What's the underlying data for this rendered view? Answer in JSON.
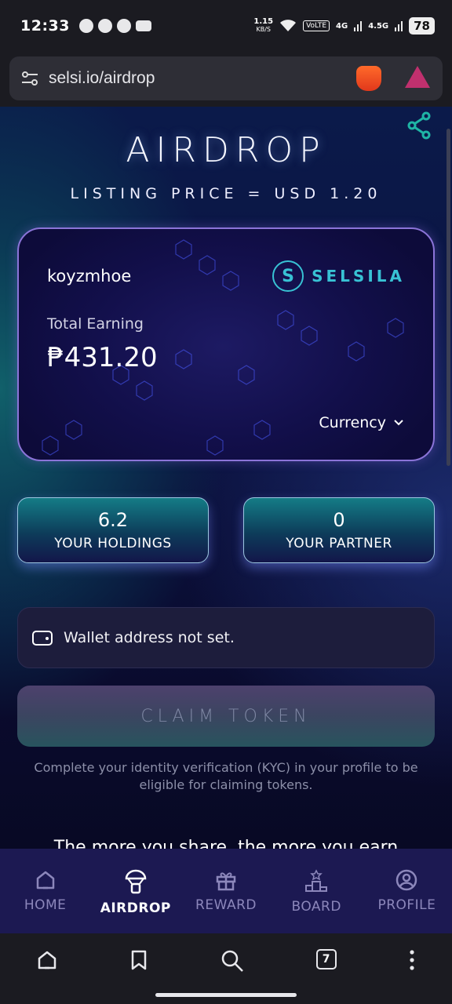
{
  "status": {
    "time": "12:33",
    "net_speed": "1.15",
    "net_unit": "KB/S",
    "volte": "VoLTE",
    "net1": "4G",
    "net2": "4.5G",
    "battery": "78"
  },
  "browser": {
    "url": "selsi.io/airdrop",
    "tab_count": "7"
  },
  "page": {
    "title": "AIRDROP",
    "listing_price": "LISTING PRICE = USD 1.20",
    "card": {
      "username": "koyzmhoe",
      "brand": "SELSILA",
      "earning_label": "Total Earning",
      "earning_value": "₱431.20",
      "currency_label": "Currency"
    },
    "holdings": {
      "value": "6.2",
      "label": "YOUR HOLDINGS"
    },
    "partner": {
      "value": "0",
      "label": "YOUR PARTNER"
    },
    "wallet_text": "Wallet address not set.",
    "claim_label": "CLAIM TOKEN",
    "kyc_note": "Complete your identity verification (KYC) in your profile to be eligible for claiming tokens.",
    "share_more": "The more you share, the more you earn"
  },
  "tabs": [
    {
      "label": "HOME",
      "icon": "home-icon"
    },
    {
      "label": "AIRDROP",
      "icon": "parachute-icon",
      "active": true
    },
    {
      "label": "REWARD",
      "icon": "gift-icon"
    },
    {
      "label": "BOARD",
      "icon": "podium-icon"
    },
    {
      "label": "PROFILE",
      "icon": "profile-icon"
    }
  ],
  "colors": {
    "accent_teal": "#38c2d4",
    "card_border": "#8b74d8",
    "tabbar": "#1c1952"
  }
}
